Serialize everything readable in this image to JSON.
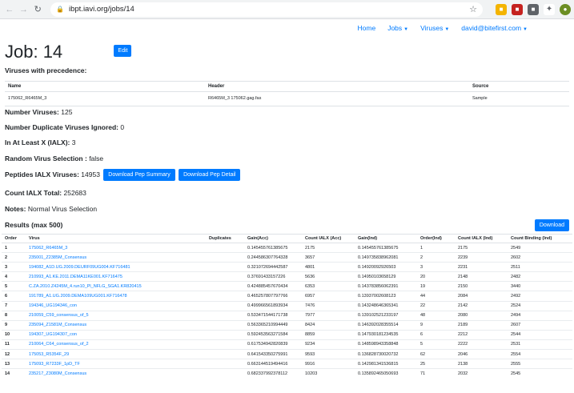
{
  "browser": {
    "url": "ibpt.iavi.org/jobs/14"
  },
  "topnav": {
    "home": "Home",
    "jobs": "Jobs",
    "viruses": "Viruses",
    "user": "david@bitefirst.com"
  },
  "job": {
    "title": "Job: 14",
    "edit_label": "Edit"
  },
  "precedence": {
    "title": "Viruses with precedence:",
    "headers": [
      "Name",
      "Header",
      "Source"
    ],
    "rows": [
      [
        "175062_R6465M_3",
        "R6465M_3 175062.gag.fas",
        "Sample"
      ]
    ]
  },
  "stats": {
    "num_viruses_label": "Number Viruses:",
    "num_viruses": "125",
    "num_dup_label": "Number Duplicate Viruses Ignored:",
    "num_dup": "0",
    "ialx_label": "In At Least X (IALX):",
    "ialx": "3",
    "random_label": "Random Virus Selection :",
    "random": "false",
    "peptides_label": "Peptides IALX Viruses:",
    "peptides": "14953",
    "pep_summary_label": "Download Pep Summary",
    "pep_detail_label": "Download Pep Detail",
    "count_total_label": "Count IALX Total:",
    "count_total": "252683",
    "notes_label": "Notes:",
    "notes": "Normal Virus Selection"
  },
  "results": {
    "title": "Results (max 500)",
    "download_label": "Download",
    "headers": [
      "Order",
      "Virus",
      "Duplicates",
      "Gain(Acc)",
      "Count IALX (Acc)",
      "Gain(Ind)",
      "Order(Ind)",
      "Count IALX (Ind)",
      "Count Binding (Ind)"
    ],
    "rows": [
      [
        "1",
        "175062_R6465M_3",
        "",
        "0.145455761385675",
        "2175",
        "0.145455761385675",
        "1",
        "2175",
        "2549"
      ],
      [
        "2",
        "235001_Z2385M_Consensus",
        "",
        "0.244586307764328",
        "3657",
        "0.149735838962081",
        "2",
        "2239",
        "2602"
      ],
      [
        "3",
        "194082_A1D.UG.2009.DEURF09UG004.KF716481",
        "",
        "0.321072694442587",
        "4801",
        "0.14920092926503",
        "3",
        "2231",
        "2511"
      ],
      [
        "4",
        "210993_A1.KE.2011.DEMA11KE001.KF716475",
        "",
        "0.37691433157226",
        "5636",
        "0.14950103658129",
        "20",
        "2148",
        "2482"
      ],
      [
        "5",
        "C.ZA.2010.Z4245M_4.run10_Pl_NFLG_SGA1.KR820415",
        "",
        "0.424885457670434",
        "6353",
        "0.143783856062391",
        "19",
        "2150",
        "3440"
      ],
      [
        "6",
        "191789_A1.UG.2009.DEMA109UG001.KF716478",
        "",
        "0.465257807797766",
        "6957",
        "0.13937002608123",
        "44",
        "2084",
        "2492"
      ],
      [
        "7",
        "194346_UG194346_con",
        "",
        "0.499966561893934",
        "7476",
        "0.143248646365341",
        "22",
        "2142",
        "2524"
      ],
      [
        "8",
        "210059_C59_consensus_of_5",
        "",
        "0.533471544171738",
        "7977",
        "0.139102521233197",
        "48",
        "2080",
        "2494"
      ],
      [
        "9",
        "235094_Z1581M_Consensus",
        "",
        "0.563365210994449",
        "8424",
        "0.146392028355514",
        "9",
        "2189",
        "2607"
      ],
      [
        "10",
        "194307_UG194307_con",
        "",
        "0.592453563271584",
        "8859",
        "0.147930181234535",
        "6",
        "2212",
        "2544"
      ],
      [
        "11",
        "210064_C64_consensus_of_2",
        "",
        "0.617534942820839",
        "9234",
        "0.148598943358848",
        "5",
        "2222",
        "2531"
      ],
      [
        "12",
        "175053_R5354F_29",
        "",
        "0.641543350275991",
        "9593",
        "0.136828730020732",
        "62",
        "2046",
        "2554"
      ],
      [
        "13",
        "175093_R7233F_1pD_TF",
        "",
        "0.663144519494416",
        "9916",
        "0.142981341536815",
        "25",
        "2138",
        "2555"
      ],
      [
        "14",
        "235217_Z3080M_Consensus",
        "",
        "0.682337992378112",
        "10203",
        "0.135892465050693",
        "71",
        "2032",
        "2545"
      ]
    ]
  },
  "colors": {
    "primary": "#007bff",
    "text": "#212529",
    "border": "#dee2e6"
  }
}
